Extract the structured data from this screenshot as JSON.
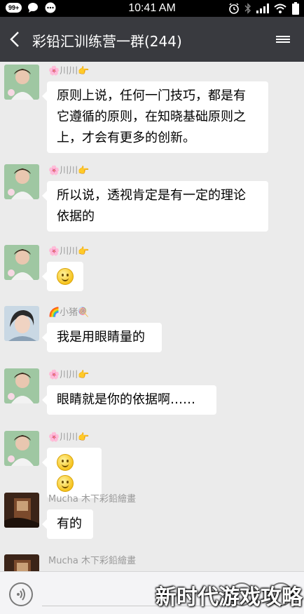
{
  "status_bar": {
    "notification_count": "99+",
    "time": "10:41 AM"
  },
  "header": {
    "title": "彩铅汇训练营一群(244)"
  },
  "messages": [
    {
      "sender": "🌸川川👉",
      "text_lines": [
        "原则上说，任何一门技巧，都是有",
        "它遵循的原则，在知晓基础原则之",
        "上，才会有更多的创新。"
      ],
      "emoji_count": 0
    },
    {
      "sender": "🌸川川👉",
      "text_lines": [
        "所以说，透视肯定是有一定的理论",
        "依据的"
      ],
      "emoji_count": 0
    },
    {
      "sender": "🌸川川👉",
      "text_lines": [],
      "emoji_count": 1
    },
    {
      "sender": "🌈小猪🍭",
      "text_lines": [
        "我是用眼睛量的"
      ],
      "emoji_count": 0
    },
    {
      "sender": "🌸川川👉",
      "text_lines": [
        "眼睛就是你的依据啊……"
      ],
      "emoji_count": 0
    },
    {
      "sender": "🌸川川👉",
      "text_lines": [],
      "emoji_count": 2
    },
    {
      "sender": "Mucha 木下彩鉛繪畫",
      "text_lines": [
        "有的"
      ],
      "emoji_count": 0
    },
    {
      "sender": "Mucha 木下彩鉛繪畫",
      "text_lines": [],
      "emoji_count": 0
    }
  ],
  "icons": {
    "back": "chevron-left-icon",
    "menu": "more-options-icon",
    "voice": "voice-icon",
    "emoji": "emoji-icon",
    "plus": "plus-icon"
  },
  "watermark": "新时代游戏攻略",
  "colors": {
    "nav_bg": "#393a3f",
    "chat_bg": "#ebebeb",
    "bubble_bg": "#ffffff"
  }
}
